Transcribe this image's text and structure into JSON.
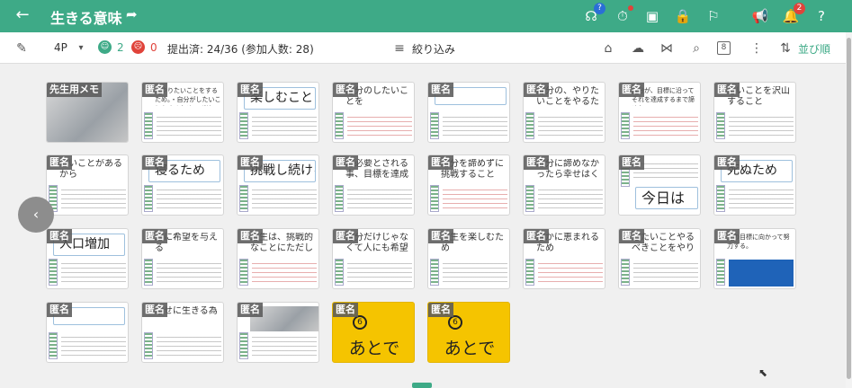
{
  "header": {
    "title": "生きる意味",
    "badge_help": "?",
    "badge_notifications": "2"
  },
  "toolbar": {
    "page_size": "4P",
    "good_count": "2",
    "bad_count": "0",
    "submitted": "提出済: 24/36 (参加人数: 28)",
    "filter_label": "絞り込み",
    "pattern_code": "8",
    "sort_label": "並び順"
  },
  "cards": [
    {
      "label": "先生用メモ",
      "type": "photo"
    },
    {
      "label": "匿名",
      "type": "small",
      "text": "・やりたいことをするため。・自分がしたいことをするため。・楽しいことをするため"
    },
    {
      "label": "匿名",
      "type": "big",
      "text": "楽しむこと"
    },
    {
      "label": "匿名",
      "type": "small",
      "text": "自分のしたいことを"
    },
    {
      "label": "匿名",
      "type": "empty"
    },
    {
      "label": "匿名",
      "type": "small",
      "text": "自分の、やりたいことをやるため"
    },
    {
      "label": "匿名",
      "type": "small",
      "text": "自分が、目標に沿ってそれを達成するまで諦めない"
    },
    {
      "label": "匿名",
      "type": "small",
      "text": "たいことを沢山すること"
    },
    {
      "label": "匿名",
      "type": "small",
      "text": "いいことがあるから"
    },
    {
      "label": "匿名",
      "type": "big",
      "text": "寝るため"
    },
    {
      "label": "匿名",
      "type": "big",
      "text": "挑戦し続ける"
    },
    {
      "label": "匿名",
      "type": "small",
      "text": "に必要とされる事、目標を達成する事"
    },
    {
      "label": "匿名",
      "type": "small",
      "text": "自分を諦めずに挑戦すること"
    },
    {
      "label": "匿名",
      "type": "small",
      "text": "自分に諦めなかったら幸せはくる"
    },
    {
      "label": "匿名",
      "type": "big2",
      "text": "今日は"
    },
    {
      "label": "匿名",
      "type": "big",
      "text": "死ぬため"
    },
    {
      "label": "匿名",
      "type": "big",
      "text": "人口増加"
    },
    {
      "label": "匿名",
      "type": "small",
      "text": "人に希望を与える"
    },
    {
      "label": "匿名",
      "type": "small",
      "text": "人生は、挑戦的なことにただした"
    },
    {
      "label": "匿名",
      "type": "small",
      "text": "自分だけじゃなくて人にも希望を与える"
    },
    {
      "label": "匿名",
      "type": "small",
      "text": "人生を楽しむため"
    },
    {
      "label": "匿名",
      "type": "small",
      "text": "誰かに恵まれるため"
    },
    {
      "label": "匿名",
      "type": "small",
      "text": "したいことやるべきことをやり切ること。"
    },
    {
      "label": "匿名",
      "type": "blue",
      "text": "その目標に向かって努力する。"
    },
    {
      "label": "匿名",
      "type": "empty"
    },
    {
      "label": "匿名",
      "type": "small",
      "text": "幸せに生きる為"
    },
    {
      "label": "匿名",
      "type": "gray"
    },
    {
      "label": "匿名",
      "type": "later",
      "num": "6",
      "text": "あとで"
    },
    {
      "label": "匿名",
      "type": "later",
      "num": "6",
      "text": "あとで"
    }
  ]
}
